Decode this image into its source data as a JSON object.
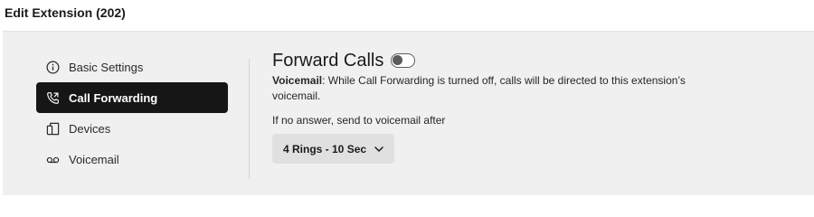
{
  "header": {
    "title": "Edit Extension (202)"
  },
  "sidebar": {
    "items": [
      {
        "label": "Basic Settings",
        "icon": "info-circle-icon",
        "active": false
      },
      {
        "label": "Call Forwarding",
        "icon": "phone-forward-icon",
        "active": true
      },
      {
        "label": "Devices",
        "icon": "devices-icon",
        "active": false
      },
      {
        "label": "Voicemail",
        "icon": "voicemail-icon",
        "active": false
      }
    ]
  },
  "main": {
    "title": "Forward Calls",
    "toggle_on": false,
    "description_bold": "Voicemail",
    "description_text": ": While Call Forwarding is turned off, calls will be directed to this extension’s voicemail.",
    "no_answer_label": "If no answer, send to voicemail after",
    "ring_select": {
      "value": "4 Rings - 10 Sec"
    }
  },
  "colors": {
    "active_nav_bg": "#161616",
    "panel_bg": "#f0f0f0",
    "dropdown_bg": "#e0e0e0"
  }
}
